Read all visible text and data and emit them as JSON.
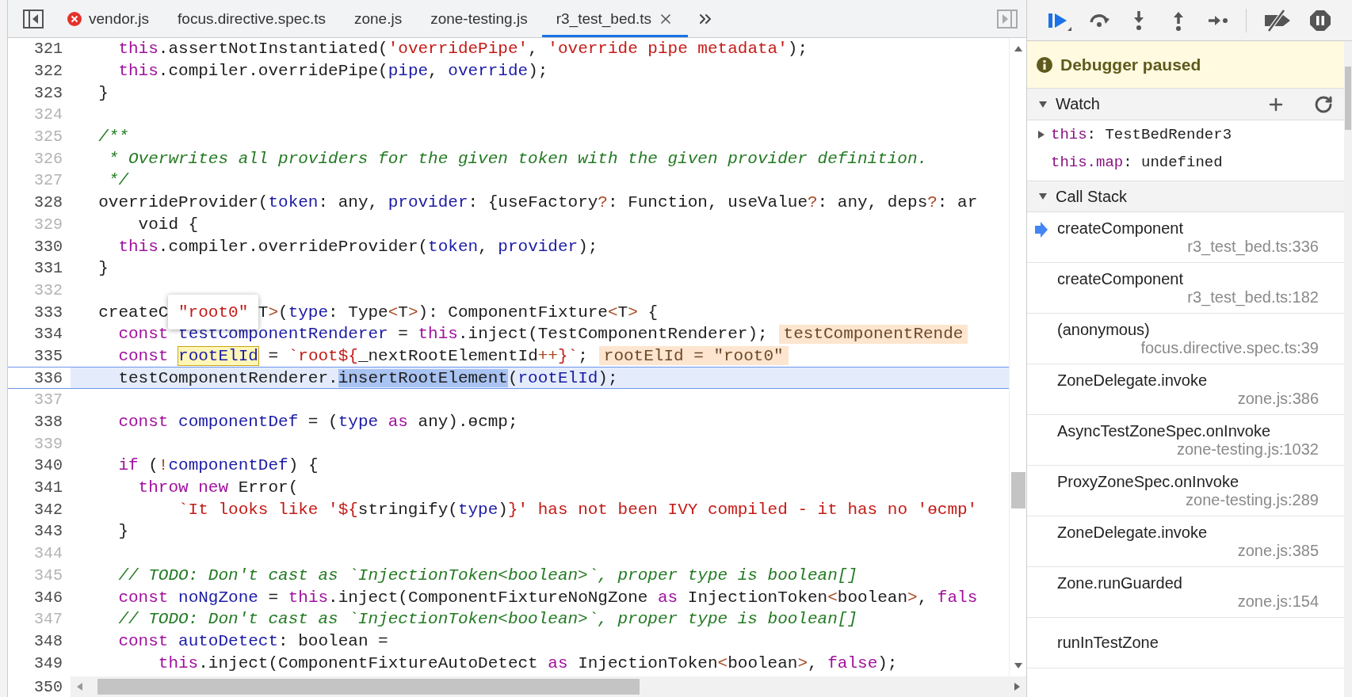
{
  "tabs": [
    {
      "label": "vendor.js",
      "selected": false,
      "error": true
    },
    {
      "label": "focus.directive.spec.ts",
      "selected": false,
      "error": false
    },
    {
      "label": "zone.js",
      "selected": false,
      "error": false
    },
    {
      "label": "zone-testing.js",
      "selected": false,
      "error": false
    },
    {
      "label": "r3_test_bed.ts",
      "selected": true,
      "error": false
    }
  ],
  "editor": {
    "lines": [
      {
        "number": "321",
        "dim": false,
        "tokens": [
          {
            "kind": "keyword",
            "text": "    this"
          },
          {
            "kind": "plain",
            "text": ".assertNotInstantiated("
          },
          {
            "kind": "string",
            "text": "'overridePipe'"
          },
          {
            "kind": "plain",
            "text": ", "
          },
          {
            "kind": "string",
            "text": "'override pipe metadata'"
          },
          {
            "kind": "plain",
            "text": ");"
          }
        ]
      },
      {
        "number": "322",
        "dim": false,
        "tokens": [
          {
            "kind": "keyword",
            "text": "    this"
          },
          {
            "kind": "plain",
            "text": ".compiler.overridePipe("
          },
          {
            "kind": "name",
            "text": "pipe"
          },
          {
            "kind": "plain",
            "text": ", "
          },
          {
            "kind": "name",
            "text": "override"
          },
          {
            "kind": "plain",
            "text": ");"
          }
        ]
      },
      {
        "number": "323",
        "dim": false,
        "tokens": [
          {
            "kind": "plain",
            "text": "  }"
          }
        ]
      },
      {
        "number": "324",
        "dim": true
      },
      {
        "number": "325",
        "dim": true,
        "tokens": [
          {
            "kind": "comment",
            "text": "  /**"
          }
        ]
      },
      {
        "number": "326",
        "dim": true,
        "tokens": [
          {
            "kind": "comment",
            "text": "   * Overwrites all providers for the given token with the given provider definition."
          }
        ]
      },
      {
        "number": "327",
        "dim": true,
        "tokens": [
          {
            "kind": "comment",
            "text": "   */"
          }
        ]
      },
      {
        "number": "328",
        "dim": false,
        "tokens": [
          {
            "kind": "plain",
            "text": "  overrideProvider("
          },
          {
            "kind": "name",
            "text": "token"
          },
          {
            "kind": "plain",
            "text": ": any, "
          },
          {
            "kind": "name",
            "text": "provider"
          },
          {
            "kind": "plain",
            "text": ": {useFactory"
          },
          {
            "kind": "operator",
            "text": "?"
          },
          {
            "kind": "plain",
            "text": ": Function, useValue"
          },
          {
            "kind": "operator",
            "text": "?"
          },
          {
            "kind": "plain",
            "text": ": any, deps"
          },
          {
            "kind": "operator",
            "text": "?"
          },
          {
            "kind": "plain",
            "text": ": ar"
          }
        ]
      },
      {
        "number": "329",
        "dim": true,
        "tokens": [
          {
            "kind": "plain",
            "text": "      void {"
          }
        ]
      },
      {
        "number": "330",
        "dim": false,
        "tokens": [
          {
            "kind": "keyword",
            "text": "    this"
          },
          {
            "kind": "plain",
            "text": ".compiler.overrideProvider("
          },
          {
            "kind": "name",
            "text": "token"
          },
          {
            "kind": "plain",
            "text": ", "
          },
          {
            "kind": "name",
            "text": "provider"
          },
          {
            "kind": "plain",
            "text": ");"
          }
        ]
      },
      {
        "number": "331",
        "dim": false,
        "tokens": [
          {
            "kind": "plain",
            "text": "  }"
          }
        ]
      },
      {
        "number": "332",
        "dim": true
      },
      {
        "number": "333",
        "dim": false,
        "tokens": [
          {
            "kind": "plain",
            "text": "  createC"
          },
          {
            "kind": "popover",
            "text": "\"root0\""
          },
          {
            "kind": "plain",
            "text": "T"
          },
          {
            "kind": "operator",
            "text": ">"
          },
          {
            "kind": "plain",
            "text": "("
          },
          {
            "kind": "name",
            "text": "type"
          },
          {
            "kind": "plain",
            "text": ": Type"
          },
          {
            "kind": "operator",
            "text": "<"
          },
          {
            "kind": "plain",
            "text": "T"
          },
          {
            "kind": "operator",
            "text": ">"
          },
          {
            "kind": "plain",
            "text": "): ComponentFixture"
          },
          {
            "kind": "operator",
            "text": "<"
          },
          {
            "kind": "plain",
            "text": "T"
          },
          {
            "kind": "operator",
            "text": ">"
          },
          {
            "kind": "plain",
            "text": " {"
          }
        ]
      },
      {
        "number": "334",
        "dim": false,
        "tokens": [
          {
            "kind": "keyword",
            "text": "    const "
          },
          {
            "kind": "name",
            "text": "testComponentRenderer"
          },
          {
            "kind": "plain",
            "text": " = "
          },
          {
            "kind": "keyword",
            "text": "this"
          },
          {
            "kind": "plain",
            "text": ".inject(TestComponentRenderer);"
          }
        ],
        "inline_value": "testComponentRende"
      },
      {
        "number": "335",
        "dim": false,
        "tokens": [
          {
            "kind": "keyword",
            "text": "    const "
          },
          {
            "kind": "hover",
            "text": "rootElId"
          },
          {
            "kind": "plain",
            "text": " = "
          },
          {
            "kind": "string",
            "text": "`root${"
          },
          {
            "kind": "plain",
            "text": "_nextRootElementId"
          },
          {
            "kind": "operator",
            "text": "++"
          },
          {
            "kind": "string",
            "text": "}`"
          },
          {
            "kind": "plain",
            "text": ";"
          }
        ],
        "inline_value": "rootElId = \"root0\""
      },
      {
        "number": "336",
        "dim": false,
        "paused": true,
        "tokens": [
          {
            "kind": "plain",
            "text": "    testComponentRenderer."
          },
          {
            "kind": "highlight",
            "text": "insertRootElement"
          },
          {
            "kind": "plain",
            "text": "("
          },
          {
            "kind": "name",
            "text": "rootElId"
          },
          {
            "kind": "plain",
            "text": ");"
          }
        ]
      },
      {
        "number": "337",
        "dim": true
      },
      {
        "number": "338",
        "dim": false,
        "tokens": [
          {
            "kind": "keyword",
            "text": "    const "
          },
          {
            "kind": "name",
            "text": "componentDef"
          },
          {
            "kind": "plain",
            "text": " = ("
          },
          {
            "kind": "name",
            "text": "type"
          },
          {
            "kind": "keyword",
            "text": " as"
          },
          {
            "kind": "plain",
            "text": " any).ɵcmp;"
          }
        ]
      },
      {
        "number": "339",
        "dim": true
      },
      {
        "number": "340",
        "dim": false,
        "tokens": [
          {
            "kind": "keyword",
            "text": "    if"
          },
          {
            "kind": "plain",
            "text": " ("
          },
          {
            "kind": "operator",
            "text": "!"
          },
          {
            "kind": "name",
            "text": "componentDef"
          },
          {
            "kind": "plain",
            "text": ") {"
          }
        ]
      },
      {
        "number": "341",
        "dim": false,
        "tokens": [
          {
            "kind": "keyword",
            "text": "      throw new"
          },
          {
            "kind": "plain",
            "text": " Error("
          }
        ]
      },
      {
        "number": "342",
        "dim": false,
        "tokens": [
          {
            "kind": "string",
            "text": "          `It looks like '${"
          },
          {
            "kind": "plain",
            "text": "stringify("
          },
          {
            "kind": "name",
            "text": "type"
          },
          {
            "kind": "plain",
            "text": ")"
          },
          {
            "kind": "string",
            "text": "}' has not been IVY compiled - it has no 'ɵcmp'"
          }
        ]
      },
      {
        "number": "343",
        "dim": false,
        "tokens": [
          {
            "kind": "plain",
            "text": "    }"
          }
        ]
      },
      {
        "number": "344",
        "dim": true
      },
      {
        "number": "345",
        "dim": true,
        "tokens": [
          {
            "kind": "comment",
            "text": "    // TODO: Don't cast as `InjectionToken<boolean>`, proper type is boolean[]"
          }
        ]
      },
      {
        "number": "346",
        "dim": false,
        "tokens": [
          {
            "kind": "keyword",
            "text": "    const "
          },
          {
            "kind": "name",
            "text": "noNgZone"
          },
          {
            "kind": "plain",
            "text": " = "
          },
          {
            "kind": "keyword",
            "text": "this"
          },
          {
            "kind": "plain",
            "text": ".inject(ComponentFixtureNoNgZone"
          },
          {
            "kind": "keyword",
            "text": " as"
          },
          {
            "kind": "plain",
            "text": " InjectionToken"
          },
          {
            "kind": "operator",
            "text": "<"
          },
          {
            "kind": "plain",
            "text": "boolean"
          },
          {
            "kind": "operator",
            "text": ">"
          },
          {
            "kind": "plain",
            "text": ", "
          },
          {
            "kind": "keyword",
            "text": "fals"
          }
        ]
      },
      {
        "number": "347",
        "dim": true,
        "tokens": [
          {
            "kind": "comment",
            "text": "    // TODO: Don't cast as `InjectionToken<boolean>`, proper type is boolean[]"
          }
        ]
      },
      {
        "number": "348",
        "dim": false,
        "tokens": [
          {
            "kind": "keyword",
            "text": "    const "
          },
          {
            "kind": "name",
            "text": "autoDetect"
          },
          {
            "kind": "plain",
            "text": ": boolean ="
          }
        ]
      },
      {
        "number": "349",
        "dim": false,
        "tokens": [
          {
            "kind": "keyword",
            "text": "        this"
          },
          {
            "kind": "plain",
            "text": ".inject(ComponentFixtureAutoDetect"
          },
          {
            "kind": "keyword",
            "text": " as"
          },
          {
            "kind": "plain",
            "text": " InjectionToken"
          },
          {
            "kind": "operator",
            "text": "<"
          },
          {
            "kind": "plain",
            "text": "boolean"
          },
          {
            "kind": "operator",
            "text": ">"
          },
          {
            "kind": "plain",
            "text": ", "
          },
          {
            "kind": "keyword",
            "text": "false"
          },
          {
            "kind": "plain",
            "text": ");"
          }
        ]
      },
      {
        "number": "350",
        "dim": false
      }
    ]
  },
  "debugger": {
    "status": "Debugger paused",
    "watch": {
      "title": "Watch",
      "expanded": true,
      "items": [
        {
          "expression": "this",
          "separator": ":",
          "value": "TestBedRender3",
          "expandable": true
        },
        {
          "expression": "this.map",
          "separator": ":",
          "value": "undefined",
          "expandable": false
        }
      ]
    },
    "call_stack": {
      "title": "Call Stack",
      "expanded": true,
      "frames": [
        {
          "name": "createComponent",
          "location": "r3_test_bed.ts:336",
          "selected": true
        },
        {
          "name": "createComponent",
          "location": "r3_test_bed.ts:182",
          "selected": false
        },
        {
          "name": "(anonymous)",
          "location": "focus.directive.spec.ts:39",
          "selected": false
        },
        {
          "name": "ZoneDelegate.invoke",
          "location": "zone.js:386",
          "selected": false
        },
        {
          "name": "AsyncTestZoneSpec.onInvoke",
          "location": "zone-testing.js:1032",
          "selected": false
        },
        {
          "name": "ProxyZoneSpec.onInvoke",
          "location": "zone-testing.js:289",
          "selected": false
        },
        {
          "name": "ZoneDelegate.invoke",
          "location": "zone.js:385",
          "selected": false
        },
        {
          "name": "Zone.runGuarded",
          "location": "zone.js:154",
          "selected": false
        },
        {
          "name": "runInTestZone",
          "selected": false
        }
      ]
    }
  }
}
